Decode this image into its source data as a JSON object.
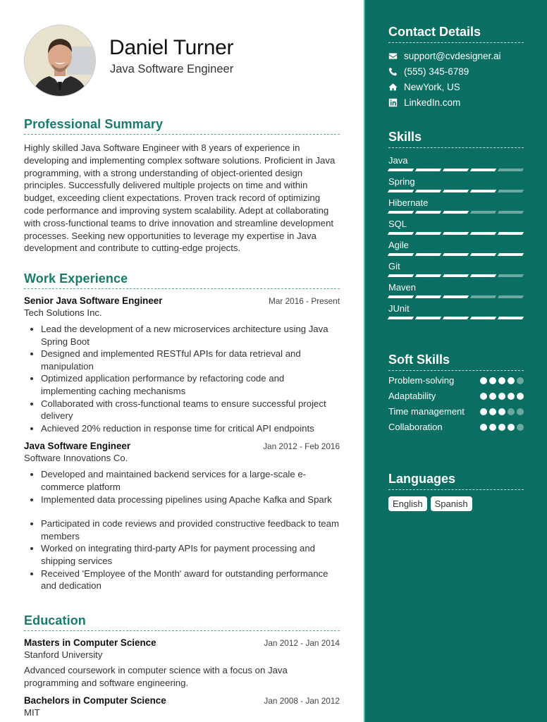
{
  "header": {
    "name": "Daniel Turner",
    "title": "Java Software Engineer",
    "avatar_alt": "profile-photo"
  },
  "summary": {
    "heading": "Professional Summary",
    "text": "Highly skilled Java Software Engineer with 8 years of experience in developing and implementing complex software solutions. Proficient in Java programming, with a strong understanding of object-oriented design principles. Successfully delivered multiple projects on time and within budget, exceeding client expectations. Proven track record of optimizing code performance and improving system scalability. Adept at collaborating with cross-functional teams to drive innovation and streamline development processes. Seeking new opportunities to leverage my expertise in Java development and contribute to cutting-edge projects."
  },
  "experience": {
    "heading": "Work Experience",
    "jobs": [
      {
        "title": "Senior Java Software Engineer",
        "date": "Mar 2016 - Present",
        "company": "Tech Solutions Inc.",
        "bullets": [
          "Lead the development of a new microservices architecture using Java Spring Boot",
          "Designed and implemented RESTful APIs for data retrieval and manipulation",
          "Optimized application performance by refactoring code and implementing caching mechanisms",
          "Collaborated with cross-functional teams to ensure successful project delivery",
          "Achieved 20% reduction in response time for critical API endpoints"
        ]
      },
      {
        "title": "Java Software Engineer",
        "date": "Jan 2012 - Feb 2016",
        "company": "Software Innovations Co.",
        "bullets": [
          "Developed and maintained backend services for a large-scale e-commerce platform",
          "Implemented data processing pipelines using Apache Kafka and Spark",
          "Participated in code reviews and provided constructive feedback to team members",
          "Worked on integrating third-party APIs for payment processing and shipping services",
          "Received 'Employee of the Month' award for outstanding performance and dedication"
        ]
      }
    ]
  },
  "education": {
    "heading": "Education",
    "items": [
      {
        "degree": "Masters in Computer Science",
        "date": "Jan 2012 - Jan 2014",
        "school": "Stanford University",
        "description": "Advanced coursework in computer science with a focus on Java programming and software engineering."
      },
      {
        "degree": "Bachelors in Computer Science",
        "date": "Jan 2008 - Jan 2012",
        "school": "MIT"
      }
    ]
  },
  "contact": {
    "heading": "Contact Details",
    "items": [
      {
        "icon": "envelope-icon",
        "text": "support@cvdesigner.ai"
      },
      {
        "icon": "phone-icon",
        "text": "(555) 345-6789"
      },
      {
        "icon": "home-icon",
        "text": "NewYork, US"
      },
      {
        "icon": "linkedin-icon",
        "text": "LinkedIn.com"
      }
    ]
  },
  "skills": {
    "heading": "Skills",
    "max_level": 5,
    "items": [
      {
        "name": "Java",
        "level": 4
      },
      {
        "name": "Spring",
        "level": 4
      },
      {
        "name": "Hibernate",
        "level": 3
      },
      {
        "name": "SQL",
        "level": 5
      },
      {
        "name": "Agile",
        "level": 5
      },
      {
        "name": "Git",
        "level": 4
      },
      {
        "name": "Maven",
        "level": 3
      },
      {
        "name": "JUnit",
        "level": 5
      }
    ]
  },
  "soft_skills": {
    "heading": "Soft Skills",
    "max_level": 5,
    "items": [
      {
        "name": "Problem-solving",
        "level": 4
      },
      {
        "name": "Adaptability",
        "level": 5
      },
      {
        "name": "Time management",
        "level": 3
      },
      {
        "name": "Collaboration",
        "level": 4
      }
    ]
  },
  "languages": {
    "heading": "Languages",
    "items": [
      "English",
      "Spanish"
    ]
  },
  "colors": {
    "accent": "#1a7a6c",
    "sidebar": "#0b6e62"
  }
}
